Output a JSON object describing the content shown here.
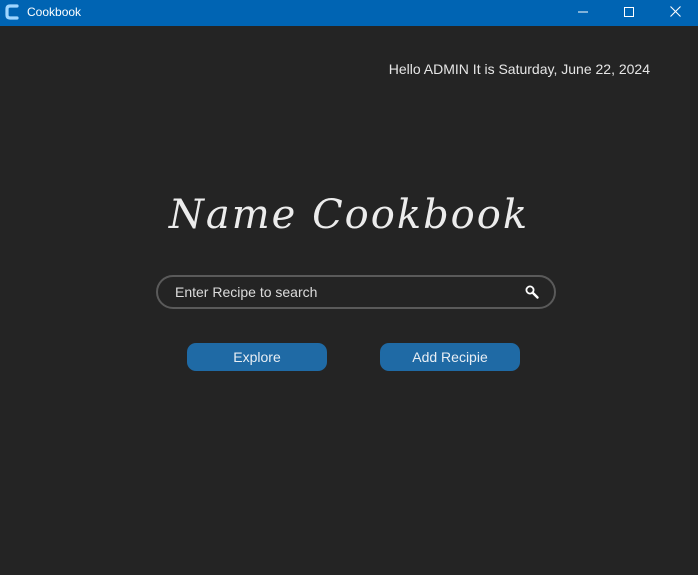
{
  "window": {
    "title": "Cookbook",
    "titlebar_color": "#0064b3",
    "background_color": "#242424",
    "controls": [
      "minimize-icon",
      "maximize-icon",
      "close-icon"
    ]
  },
  "header": {
    "greeting": "Hello ADMIN It is Saturday, June 22, 2024"
  },
  "main": {
    "heading": "Name Cookbook",
    "search": {
      "placeholder": "Enter Recipe to search",
      "value": "",
      "icon": "search-icon"
    },
    "buttons": {
      "explore_label": "Explore",
      "add_label": "Add Recipie",
      "accent_color": "#1f6aa5"
    }
  }
}
